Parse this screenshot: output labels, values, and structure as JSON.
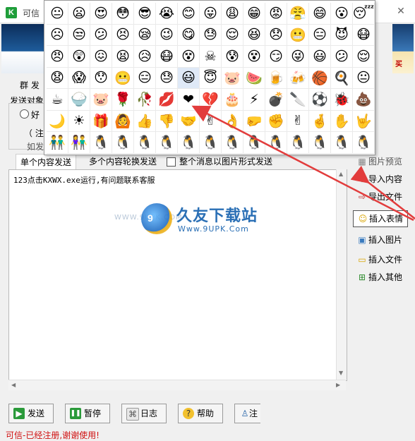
{
  "window": {
    "app_title": "可信",
    "logo_letter": "K",
    "close_glyph": "✕"
  },
  "banner": {
    "right_text": "买"
  },
  "top": {
    "nav_text": "群 发",
    "send_to_label": "发送对象",
    "radio_label": "好",
    "note_label": "（ 注意",
    "example_label": "如发"
  },
  "tabs": {
    "tab_single": "单个内容发送",
    "tab_multi": "多个内容轮换发送",
    "image_mode_checkbox": "整个消息以图片形式发送"
  },
  "editor": {
    "content": "123点击KXWX.exe运行,有问题联系客服"
  },
  "watermark": {
    "logo_text": "9",
    "url_left": "WWW.9UPK.COM",
    "cn_title": "久友下载站",
    "en_url": "Www.9UPK.Com"
  },
  "side_buttons": [
    {
      "label": "图片预览",
      "icon": "image-preview-icon",
      "glyph": "▦"
    },
    {
      "label": "导入内容",
      "icon": "import-icon",
      "glyph": "⇩"
    },
    {
      "label": "导出文件",
      "icon": "export-icon",
      "glyph": "⇨"
    },
    {
      "label": "插入表情",
      "icon": "smiley-icon",
      "glyph": "☺"
    },
    {
      "label": "插入图片",
      "icon": "picture-icon",
      "glyph": "▣"
    },
    {
      "label": "插入文件",
      "icon": "folder-icon",
      "glyph": "▭"
    },
    {
      "label": "插入其他",
      "icon": "insert-other-icon",
      "glyph": "⊞"
    }
  ],
  "bottom_buttons": [
    {
      "label": "发送",
      "icon": "play-icon",
      "glyph": "▶"
    },
    {
      "label": "暂停",
      "icon": "pause-icon",
      "glyph": "❚❚"
    },
    {
      "label": "日志",
      "icon": "log-icon",
      "glyph": "⌘"
    },
    {
      "label": "帮助",
      "icon": "help-icon",
      "glyph": "?"
    },
    {
      "label": "注册",
      "icon": "register-icon",
      "glyph": "♙"
    }
  ],
  "status": {
    "text": "可信-已经注册,谢谢使用!"
  },
  "emoji_panel": {
    "highlight_index": 51,
    "emojis": [
      "😐",
      "😦",
      "😍",
      "😳",
      "😎",
      "😭",
      "😊",
      "😛",
      "😩",
      "😁",
      "😡",
      "😤",
      "😄",
      "😮",
      "😴",
      "☹",
      "😒",
      "😕",
      "😣",
      "😪",
      "😉",
      "😋",
      "😓",
      "😌",
      "😆",
      "😞",
      "😬",
      "😑",
      "😈",
      "😷",
      "😠",
      "😲",
      "😖",
      "😫",
      "😥",
      "😷",
      "😵",
      "☠",
      "😰",
      "😵",
      "😏",
      "😜",
      "😃",
      "😕",
      "😌",
      "😧",
      "😱",
      "😯",
      "😬",
      "😑",
      "😓",
      "😃",
      "😇",
      "🐷",
      "🍉",
      "🍺",
      "🍻",
      "🏀",
      "🍳",
      "😐",
      "☕",
      "🍚",
      "🐷",
      "🌹",
      "🥀",
      "💋",
      "❤",
      "💔",
      "🎂",
      "⚡",
      "💣",
      "🔪",
      "⚽",
      "🐞",
      "💩",
      "🌙",
      "☀",
      "🎁",
      "🙆",
      "👍",
      "👎",
      "🤝",
      "✌",
      "👌",
      "🤛",
      "✊",
      "✌",
      "🤞",
      "✋",
      "🤟",
      "👬",
      "👫",
      "🐧",
      "🐧",
      "🐧",
      "🐧",
      "🐧",
      "🐧",
      "🐧",
      "🐧",
      "🐧",
      "🐧",
      "🐧",
      "🐧",
      "🐧"
    ]
  },
  "colors": {
    "accent_red": "#e23c3c",
    "brand_blue": "#2a6fb5",
    "status_red": "#d01010"
  }
}
